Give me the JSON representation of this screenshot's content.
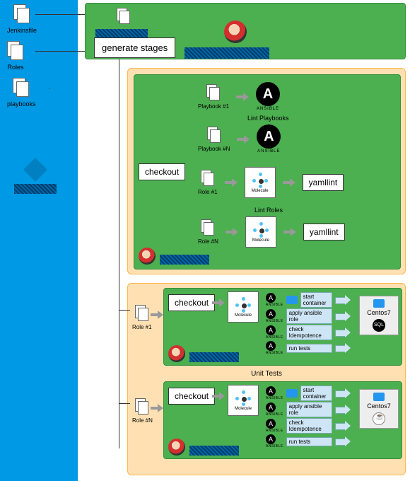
{
  "sidebar": {
    "items": [
      {
        "label": "Jenkinsfile"
      },
      {
        "label": "Roles"
      },
      {
        "label": "playbooks"
      }
    ]
  },
  "top": {
    "generate_label": "generate stages"
  },
  "lint": {
    "checkout_label": "checkout",
    "playbook1": "Playbook #1",
    "playbookN": "Playbook #N",
    "role1": "Role #1",
    "roleN": "Role #N",
    "ansible_label": "ANSIBLE",
    "molecule_label": "Molecule",
    "yamllint_label": "yamllint",
    "lint_playbooks": "Lint Playbooks",
    "lint_roles": "Lint Roles"
  },
  "unit": {
    "title": "Unit Tests",
    "role1": "Role #1",
    "roleN": "Role #N",
    "checkout_label": "checkout",
    "molecule_label": "Molecule",
    "steps": {
      "start": "start container",
      "apply": "apply ansible role",
      "idem": "check Idempotence",
      "run": "run tests"
    },
    "target1": "Centos7",
    "target1_db": "SQL",
    "target2": "Centos7"
  }
}
